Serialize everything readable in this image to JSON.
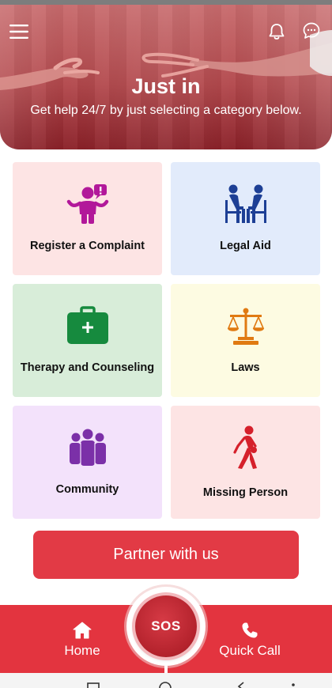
{
  "header": {
    "title": "Just in",
    "subtitle": "Get help 24/7 by just selecting a category below.",
    "menu_icon": "hamburger-menu-icon",
    "notification_icon": "bell-icon",
    "chat_icon": "chat-bubble-icon"
  },
  "categories": [
    {
      "label": "Register a Complaint",
      "icon": "complaint-person-icon",
      "bg": "#fde4e4"
    },
    {
      "label": "Legal Aid",
      "icon": "consultation-icon",
      "bg": "#e2ebfb"
    },
    {
      "label": "Therapy and Counseling",
      "icon": "medical-kit-icon",
      "bg": "#d8edd9"
    },
    {
      "label": "Laws",
      "icon": "scales-of-justice-icon",
      "bg": "#fdfbe2"
    },
    {
      "label": "Community",
      "icon": "group-of-people-icon",
      "bg": "#f3e2fb"
    },
    {
      "label": "Missing Person",
      "icon": "walking-person-icon",
      "bg": "#fde4e4"
    }
  ],
  "partner_button": {
    "label": "Partner with us"
  },
  "bottom_nav": {
    "home_label": "Home",
    "sos_label": "SOS",
    "quick_call_label": "Quick Call"
  },
  "colors": {
    "accent": "#e3343f",
    "sos": "#b3222c",
    "complaint_icon": "#b2189a",
    "legal_icon": "#1d3f95",
    "therapy_icon": "#168a3e",
    "laws_icon": "#e07a12",
    "community_icon": "#7b30a8",
    "missing_icon": "#d5202b"
  }
}
